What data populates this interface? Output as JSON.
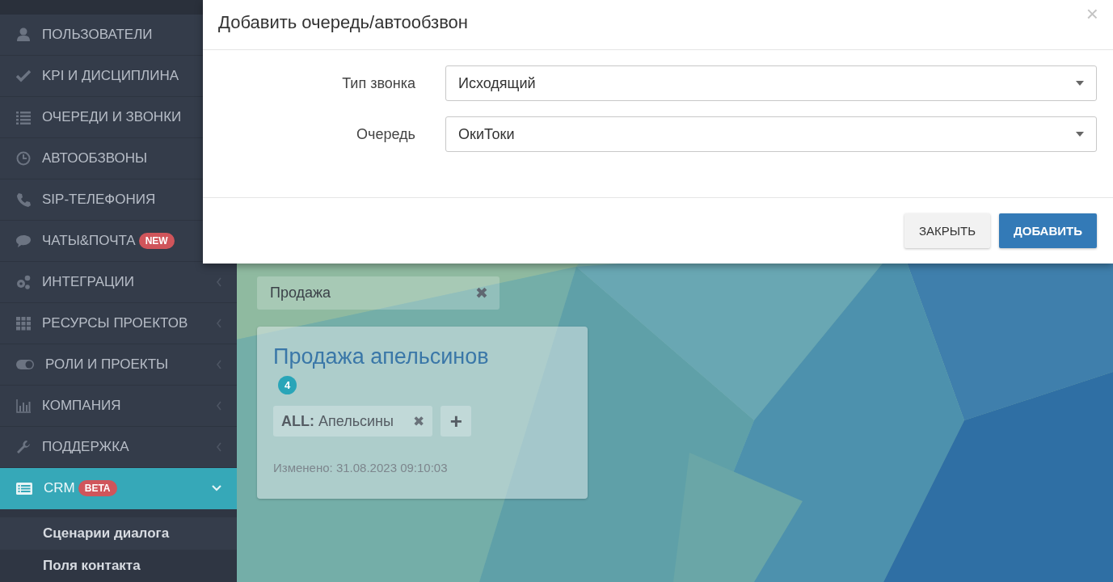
{
  "sidebar": {
    "items": [
      {
        "label": "ПОЛЬЗОВАТЕЛИ",
        "selected": false
      },
      {
        "label": "KPI И ДИСЦИПЛИНА",
        "selected": false
      },
      {
        "label": "ОЧЕРЕДИ И ЗВОНКИ",
        "selected": false
      },
      {
        "label": "АВТООБЗВОНЫ",
        "selected": false
      },
      {
        "label": "SIP-ТЕЛЕФОНИЯ",
        "selected": false
      },
      {
        "label": "ЧАТЫ&ПОЧТА",
        "badge": "NEW",
        "selected": false
      },
      {
        "label": "ИНТЕГРАЦИИ",
        "expanded": false,
        "selected": false
      },
      {
        "label": "РЕСУРСЫ ПРОЕКТОВ",
        "expanded": false,
        "selected": false
      },
      {
        "label": "РОЛИ И ПРОЕКТЫ",
        "expanded": false,
        "selected": false
      },
      {
        "label": "КОМПАНИЯ",
        "expanded": false,
        "selected": false
      },
      {
        "label": "ПОДДЕРЖКА",
        "expanded": false,
        "selected": false
      },
      {
        "label": "CRM",
        "badge": "BETA",
        "expanded": true,
        "selected": true,
        "children": [
          {
            "label": "Сценарии диалога",
            "selected": true
          },
          {
            "label": "Поля контакта",
            "selected": false
          }
        ]
      }
    ]
  },
  "filter": {
    "value": "Продажа",
    "clear": "✖"
  },
  "card": {
    "title": "Продажа апельсинов",
    "count": "4",
    "tags": [
      {
        "text": "**ALL:** Апельсины",
        "remove": "✖"
      }
    ],
    "add": "+",
    "modified": "Изменено: 31.08.2023 09:10:03"
  },
  "dialog": {
    "title": "Добавить очередь/автообзвон",
    "close": "×",
    "fields": [
      {
        "label": "Тип звонка",
        "value": "Исходящий"
      },
      {
        "label": "Очередь",
        "value": "ОкиТоки"
      }
    ],
    "buttons": [
      {
        "label": "ЗАКРЫТЬ",
        "kind": "default"
      },
      {
        "label": "ДОБАВИТЬ",
        "kind": "primary"
      }
    ]
  }
}
